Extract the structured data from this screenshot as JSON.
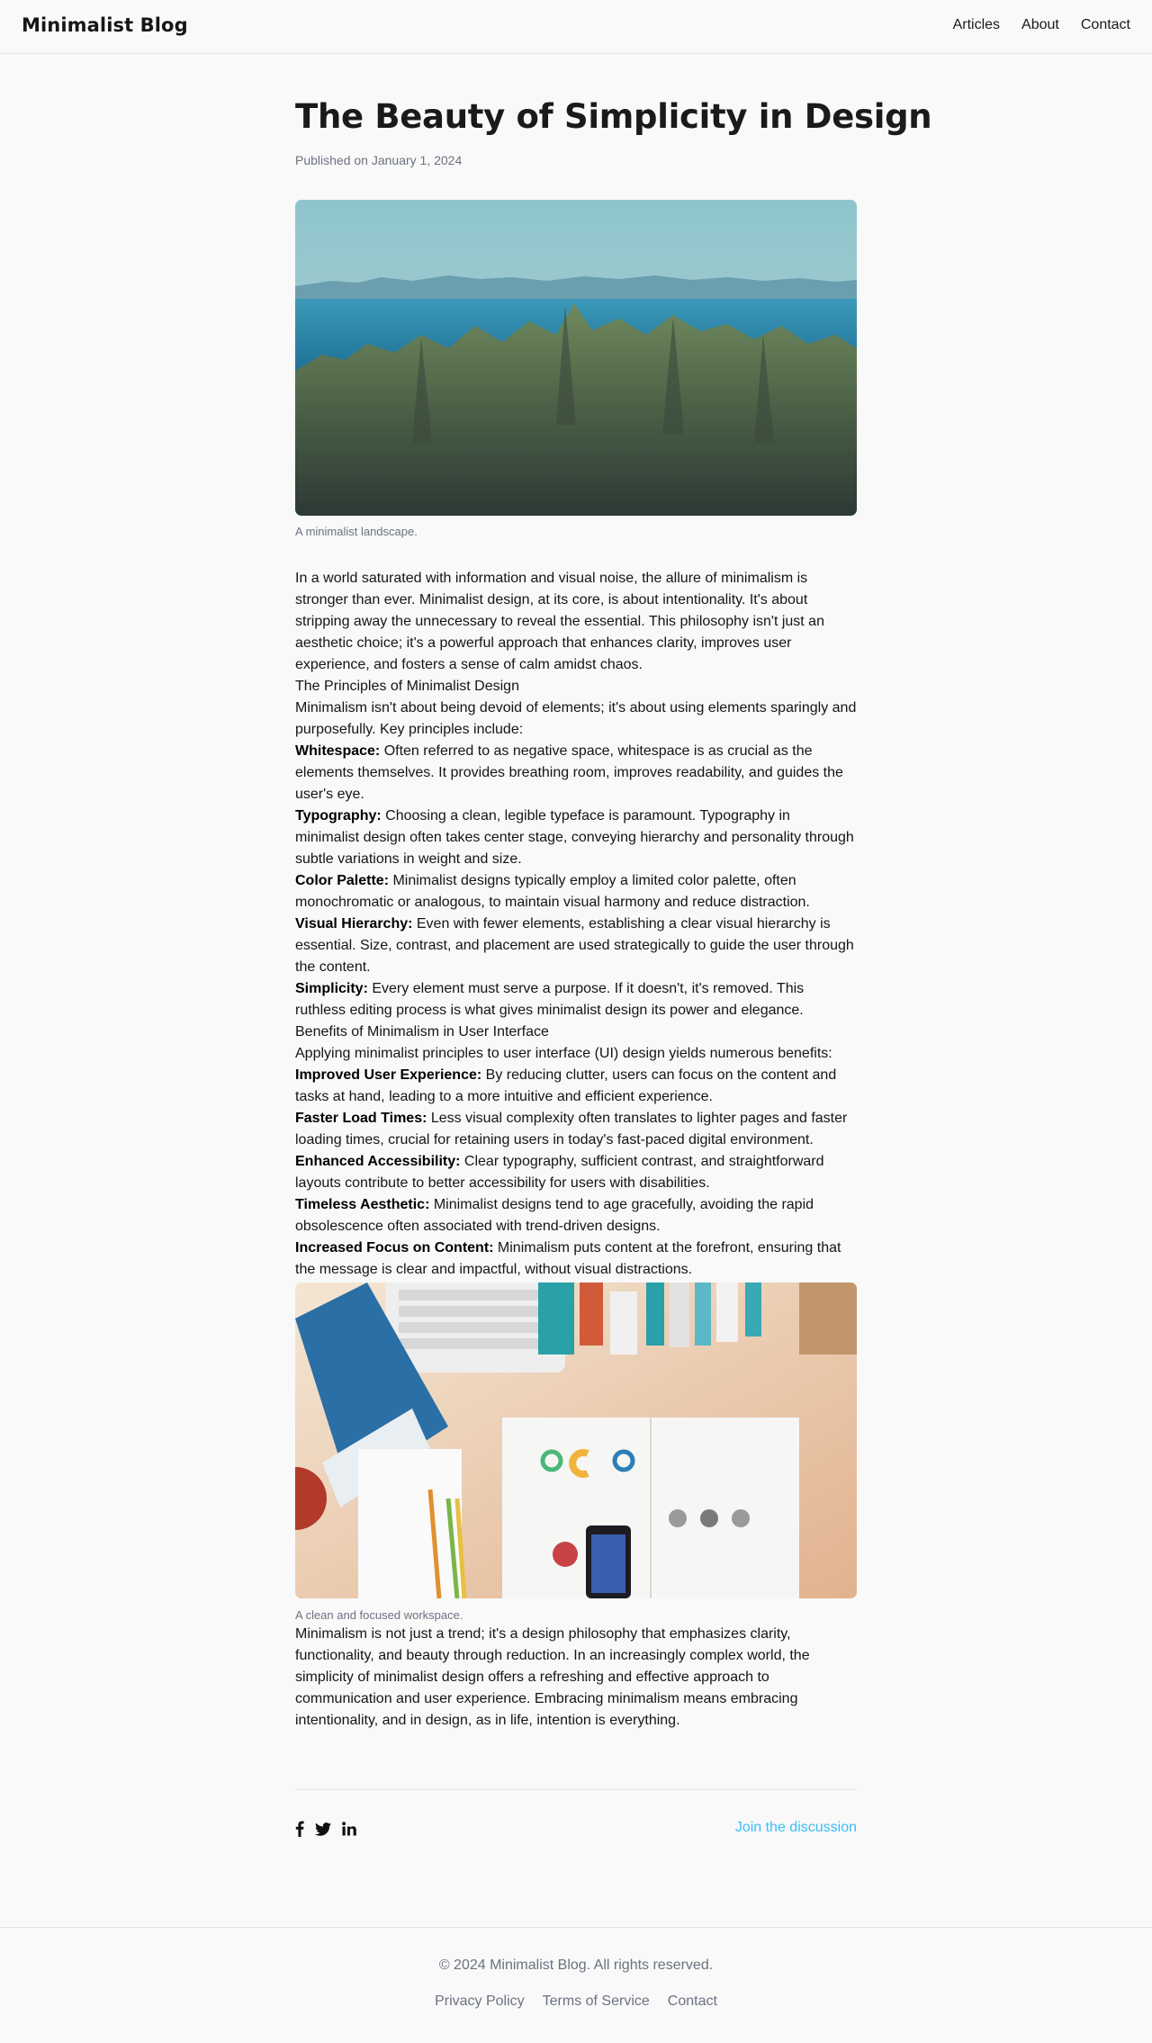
{
  "header": {
    "brand": "Minimalist Blog",
    "nav": [
      "Articles",
      "About",
      "Contact"
    ]
  },
  "article": {
    "title": "The Beauty of Simplicity in Design",
    "published": "Published on January 1, 2024",
    "hero_caption": "A minimalist landscape.",
    "intro": "In a world saturated with information and visual noise, the allure of minimalism is stronger than ever. Minimalist design, at its core, is about intentionality. It's about stripping away the unnecessary to reveal the essential. This philosophy isn't just an aesthetic choice; it's a powerful approach that enhances clarity, improves user experience, and fosters a sense of calm amidst chaos.",
    "section1": {
      "heading": "The Principles of Minimalist Design",
      "lead": "Minimalism isn't about being devoid of elements; it's about using elements sparingly and purposefully. Key principles include:",
      "items": [
        {
          "term": "Whitespace:",
          "text": " Often referred to as negative space, whitespace is as crucial as the elements themselves. It provides breathing room, improves readability, and guides the user's eye."
        },
        {
          "term": "Typography:",
          "text": " Choosing a clean, legible typeface is paramount. Typography in minimalist design often takes center stage, conveying hierarchy and personality through subtle variations in weight and size."
        },
        {
          "term": "Color Palette:",
          "text": " Minimalist designs typically employ a limited color palette, often monochromatic or analogous, to maintain visual harmony and reduce distraction."
        },
        {
          "term": "Visual Hierarchy:",
          "text": " Even with fewer elements, establishing a clear visual hierarchy is essential. Size, contrast, and placement are used strategically to guide the user through the content."
        },
        {
          "term": "Simplicity:",
          "text": " Every element must serve a purpose. If it doesn't, it's removed. This ruthless editing process is what gives minimalist design its power and elegance."
        }
      ]
    },
    "section2": {
      "heading": "Benefits of Minimalism in User Interface",
      "lead": "Applying minimalist principles to user interface (UI) design yields numerous benefits:",
      "items": [
        {
          "term": "Improved User Experience:",
          "text": " By reducing clutter, users can focus on the content and tasks at hand, leading to a more intuitive and efficient experience."
        },
        {
          "term": "Faster Load Times:",
          "text": " Less visual complexity often translates to lighter pages and faster loading times, crucial for retaining users in today's fast-paced digital environment."
        },
        {
          "term": "Enhanced Accessibility:",
          "text": " Clear typography, sufficient contrast, and straightforward layouts contribute to better accessibility for users with disabilities."
        },
        {
          "term": "Timeless Aesthetic:",
          "text": " Minimalist designs tend to age gracefully, avoiding the rapid obsolescence often associated with trend-driven designs."
        },
        {
          "term": "Increased Focus on Content:",
          "text": " Minimalism puts content at the forefront, ensuring that the message is clear and impactful, without visual distractions."
        }
      ]
    },
    "workspace_caption": "A clean and focused workspace.",
    "closing": "Minimalism is not just a trend; it's a design philosophy that emphasizes clarity, functionality, and beauty through reduction. In an increasingly complex world, the simplicity of minimalist design offers a refreshing and effective approach to communication and user experience. Embracing minimalism means embracing intentionality, and in design, as in life, intention is everything.",
    "share_icons": [
      "facebook-icon",
      "twitter-icon",
      "linkedin-icon"
    ],
    "discussion_link": "Join the discussion",
    "accent_color": "#38bdf8"
  },
  "footer": {
    "copyright": "© 2024 Minimalist Blog. All rights reserved.",
    "links": [
      "Privacy Policy",
      "Terms of Service",
      "Contact"
    ]
  }
}
